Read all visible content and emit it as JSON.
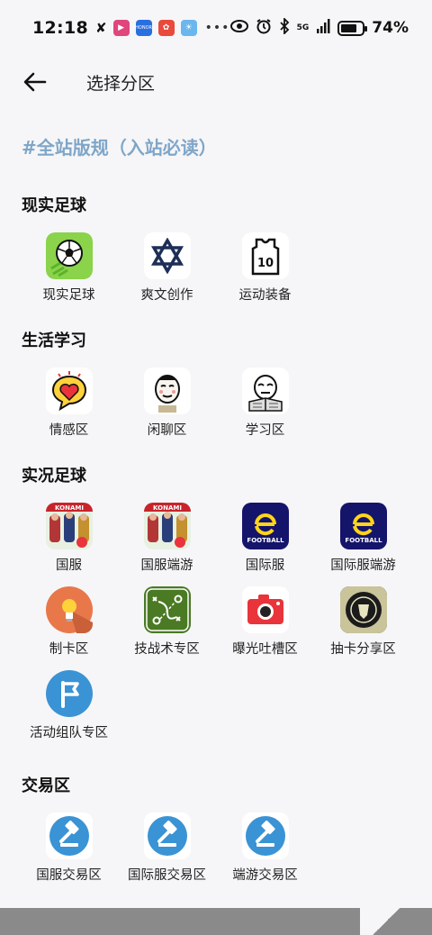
{
  "status_bar": {
    "time": "12:18",
    "network": "5G",
    "battery_level": 74,
    "battery": "74%"
  },
  "header": {
    "title": "选择分区"
  },
  "notice": "#全站版规（入站必读）",
  "sections": [
    {
      "title": "现实足球",
      "items": [
        {
          "label": "现实足球",
          "icon": "soccer-ball-icon"
        },
        {
          "label": "爽文创作",
          "icon": "star-of-david-icon"
        },
        {
          "label": "运动装备",
          "icon": "jersey-icon"
        }
      ]
    },
    {
      "title": "生活学习",
      "items": [
        {
          "label": "情感区",
          "icon": "heart-bubble-icon"
        },
        {
          "label": "闲聊区",
          "icon": "chat-meme-icon"
        },
        {
          "label": "学习区",
          "icon": "study-meme-icon"
        }
      ]
    },
    {
      "title": "实况足球",
      "items": [
        {
          "label": "国服",
          "icon": "konami-cover-icon"
        },
        {
          "label": "国服端游",
          "icon": "konami-cover-icon"
        },
        {
          "label": "国际服",
          "icon": "efootball-icon"
        },
        {
          "label": "国际服端游",
          "icon": "efootball-icon"
        },
        {
          "label": "制卡区",
          "icon": "lightbulb-icon"
        },
        {
          "label": "技战术专区",
          "icon": "tactics-board-icon"
        },
        {
          "label": "曝光吐槽区",
          "icon": "camera-icon"
        },
        {
          "label": "抽卡分享区",
          "icon": "card-emblem-icon"
        },
        {
          "label": "活动组队专区",
          "icon": "flag-icon"
        }
      ]
    },
    {
      "title": "交易区",
      "items": [
        {
          "label": "国服交易区",
          "icon": "gavel-icon"
        },
        {
          "label": "国际服交易区",
          "icon": "gavel-icon"
        },
        {
          "label": "端游交易区",
          "icon": "gavel-icon"
        }
      ]
    }
  ],
  "efootball_text": "FOOTBALL",
  "konami_text": "KONAMI",
  "jersey_number": "10",
  "colors": {
    "background": "#f6f6f8",
    "notice": "#7fa6c8",
    "efootball_bg": "#15146b",
    "gavel_blue": "#3a93d4"
  }
}
